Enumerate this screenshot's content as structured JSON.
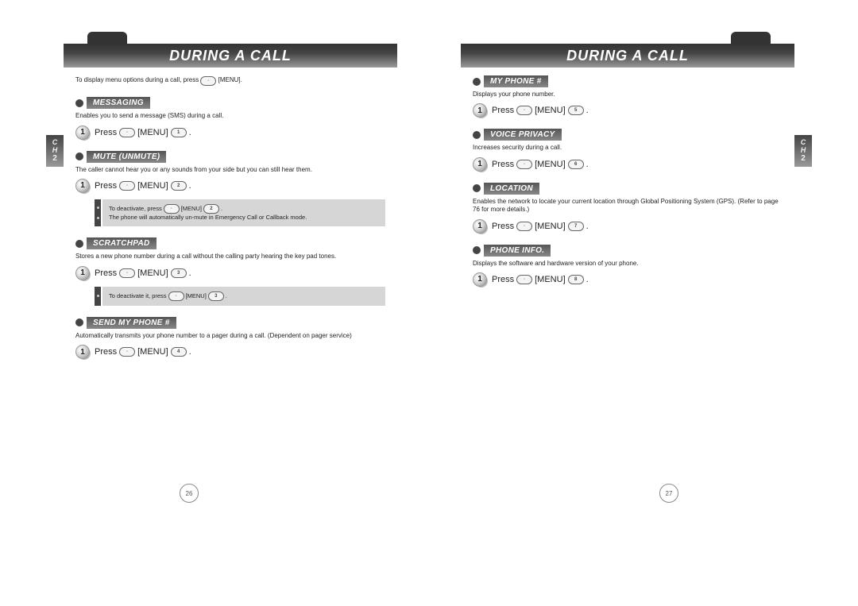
{
  "header_title": "DURING A CALL",
  "chapter_label_line1": "C",
  "chapter_label_line2": "H",
  "chapter_number": "2",
  "page_left_number": "26",
  "page_right_number": "27",
  "intro": "To display menu options during a call, press       [MENU].",
  "intro_prefix": "To display menu options during a call, press ",
  "intro_suffix": " [MENU].",
  "menu_label": "[MENU]",
  "press_label": "Press",
  "step_number": "1",
  "sections": {
    "messaging": {
      "title": "MESSAGING",
      "desc": "Enables you to send a message (SMS) during a call.",
      "key": "1"
    },
    "mute": {
      "title": "MUTE (UNMUTE)",
      "desc": "The caller cannot hear you or any sounds from your side but you can still hear them.",
      "key": "2",
      "note1_prefix": "To deactivate, press ",
      "note1_suffix": " [MENU] ",
      "note1_key": "2",
      "note2": "The phone will automatically un-mute in Emergency Call or Callback mode."
    },
    "scratchpad": {
      "title": "SCRATCHPAD",
      "desc": "Stores a new phone number during a call without the calling party hearing the key pad tones.",
      "key": "3",
      "note_prefix": "To deactivate it, press ",
      "note_suffix": " [MENU] ",
      "note_key": "3"
    },
    "sendmyphone": {
      "title": "SEND MY PHONE #",
      "desc": "Automatically transmits your phone number to a pager during a call. (Dependent on pager service)",
      "key": "4"
    },
    "myphone": {
      "title": "MY PHONE #",
      "desc": "Displays your phone number.",
      "key": "5"
    },
    "voiceprivacy": {
      "title": "VOICE PRIVACY",
      "desc": "Increases security during a call.",
      "key": "6"
    },
    "location": {
      "title": "LOCATION",
      "desc": "Enables the network to locate your current location through Global Positioning System (GPS). (Refer to page 76 for more details.)",
      "key": "7"
    },
    "phoneinfo": {
      "title": "PHONE INFO.",
      "desc": "Displays the software and hardware version of your phone.",
      "key": "8"
    }
  }
}
